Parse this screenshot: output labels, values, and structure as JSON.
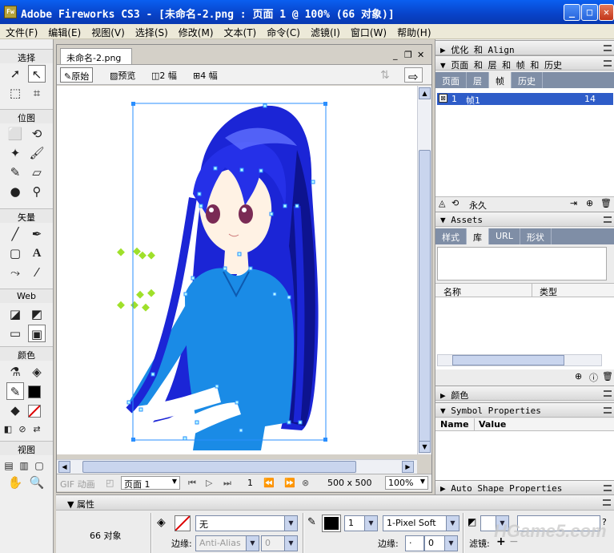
{
  "window": {
    "app_icon_text": "Fw",
    "title": "Adobe Fireworks CS3 - [未命名-2.png : 页面 1 @ 100% (66 对象)]"
  },
  "menu": [
    "文件(F)",
    "编辑(E)",
    "视图(V)",
    "选择(S)",
    "修改(M)",
    "文本(T)",
    "命令(C)",
    "滤镜(I)",
    "窗口(W)",
    "帮助(H)"
  ],
  "tools": {
    "select": "选择",
    "bitmap": "位图",
    "vector": "矢量",
    "web": "Web",
    "colors": "颜色",
    "view": "视图"
  },
  "document": {
    "tab": "未命名-2.png",
    "views": {
      "original": "原始",
      "preview": "预览",
      "two_up": "2 幅",
      "four_up": "4 幅"
    },
    "status": {
      "gif_anim": "GIF 动画",
      "page": "页面 1",
      "frame": "1",
      "size": "500 x 500",
      "zoom": "100%"
    }
  },
  "right_panels": {
    "optimize": "优化 和 Align",
    "pages_frames": "页面 和 层 和 帧 和 历史",
    "tabs1": [
      "页面",
      "层",
      "帧",
      "历史"
    ],
    "frame_row": {
      "index": "1",
      "name": "帧1",
      "delay": "14"
    },
    "forever": "永久",
    "assets": "Assets",
    "tabs2": [
      "样式",
      "库",
      "URL",
      "形状"
    ],
    "lib_columns": [
      "名称",
      "类型"
    ],
    "colors": "颜色",
    "symbol_props": "Symbol Properties",
    "symbol_columns": [
      "Name",
      "Value"
    ],
    "auto_shape": "Auto Shape Properties"
  },
  "properties": {
    "title": "属性",
    "objects": "66 对象",
    "fill_value": "无",
    "edge_label": "边缘:",
    "edge_value": "Anti-Alias",
    "edge_amount": "0",
    "stroke_size": "1",
    "stroke_type": "1-Pixel Soft",
    "stroke_edge_label": "边缘:",
    "stroke_edge_value": "0",
    "filters_label": "滤镜:",
    "plus": "+",
    "minus": "−"
  },
  "watermark": "HGame5.com"
}
